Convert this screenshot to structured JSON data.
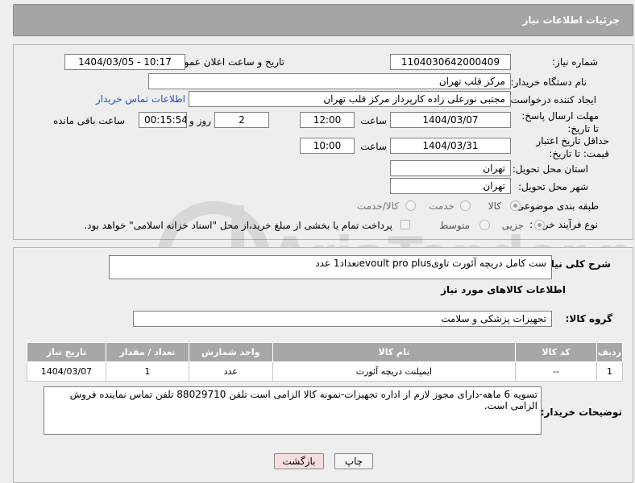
{
  "header": {
    "title": "جزئیات اطلاعات نیاز"
  },
  "form": {
    "need_number": {
      "label": "شماره نیاز:",
      "value": "1104030642000409"
    },
    "announce": {
      "label": "تاریخ و ساعت اعلان عمومی:",
      "value": "1404/03/05 - 10:17"
    },
    "buyer_org": {
      "label": "نام دستگاه خریدار:",
      "value": "مرکز قلب تهران"
    },
    "creator": {
      "label": "ایجاد کننده درخواست:",
      "value": "مجتبی نورعلی زاده کارپرداز مرکز قلب تهران",
      "contact_link": "اطلاعات تماس خریدار"
    },
    "deadline": {
      "label": "مهلت ارسال پاسخ: تا تاریخ:",
      "date": "1404/03/07",
      "time_label": "ساعت",
      "time": "12:00",
      "days": "2",
      "days_label": "روز و",
      "remaining": "00:15:54",
      "remaining_label": "ساعت باقی مانده"
    },
    "validity": {
      "label": "حداقل تاریخ اعتبار قیمت: تا تاریخ:",
      "date": "1404/03/31",
      "time_label": "ساعت",
      "time": "10:00"
    },
    "province": {
      "label": "استان محل تحویل:",
      "value": "تهران"
    },
    "city": {
      "label": "شهر محل تحویل:",
      "value": "تهران"
    },
    "category": {
      "label": "طبقه بندی موضوعی:",
      "options": [
        "کالا",
        "خدمت",
        "کالا/خدمت"
      ],
      "selected": "کالا"
    },
    "process": {
      "label": "نوع فرآیند خرید :",
      "options": [
        "جزیی",
        "متوسط"
      ],
      "selected": "جزیی",
      "checkbox_text": "پرداخت تمام یا بخشی از مبلغ خرید،از محل \"اسناد خزانه اسلامی\" خواهد بود."
    }
  },
  "description": {
    "label": "شرح کلی نیاز:",
    "value": "ست کامل دریچه آئورت تاویevoult pro plusتعداد1 عدد"
  },
  "items_section": {
    "title": "اطلاعات کالاهای مورد نیاز",
    "group_label": "گروه کالا:",
    "group_value": "تجهیزات پزشکی و سلامت",
    "table": {
      "headers": [
        "ردیف",
        "کد کالا",
        "نام کالا",
        "واحد شمارش",
        "تعداد / مقدار",
        "تاریخ نیاز"
      ],
      "rows": [
        [
          "1",
          "--",
          "ایمپلنت دریچه آئورت",
          "عدد",
          "1",
          "1404/03/07"
        ]
      ]
    }
  },
  "buyer_notes": {
    "label": "توضیحات خریدار:",
    "value": "تسویه 6 ماهه-دارای مجوز لازم از اداره تجهیزات-نمونه کالا الزامی است تلفن 88029710 تلفن تماس نماینده فروش الزامی است."
  },
  "buttons": {
    "print": "چاپ",
    "back": "بازگشت"
  },
  "watermark": {
    "text": "AriaTender.neT"
  },
  "colors": {
    "header_bg": "#a5a5a5",
    "link": "#1a56c8",
    "back_button_bg": "#f6dede"
  }
}
